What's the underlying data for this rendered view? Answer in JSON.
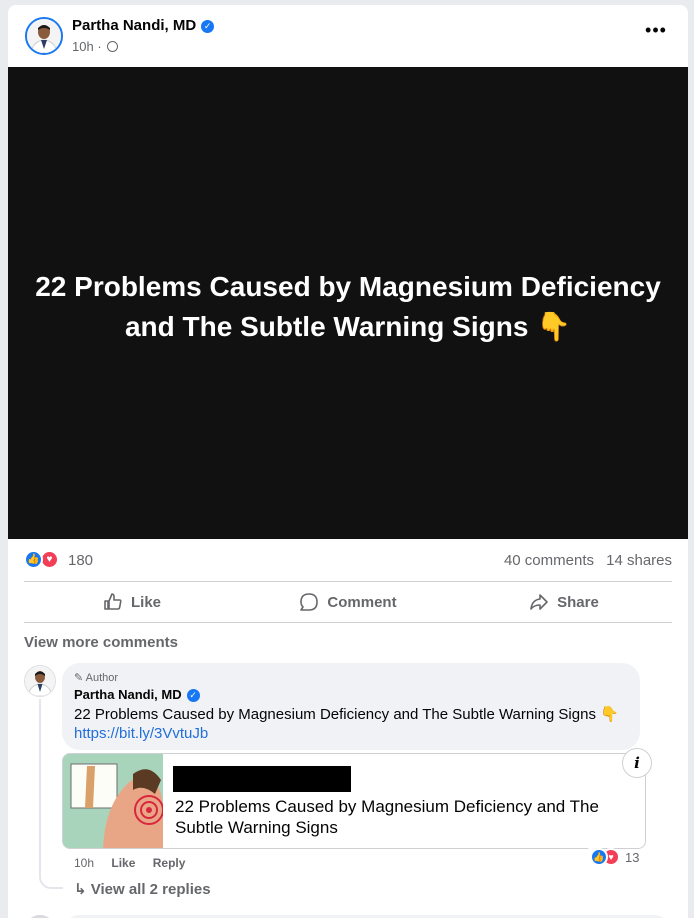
{
  "post": {
    "author": "Partha Nandi, MD",
    "verified_mark": "✓",
    "time": "10h",
    "separator": "·",
    "more_label": "•••",
    "media_text": "22 Problems Caused by Magnesium Deficiency and The Subtle Warning Signs 👇"
  },
  "stats": {
    "reaction_count": "180",
    "comments": "40 comments",
    "shares": "14 shares"
  },
  "actions": {
    "like": "Like",
    "comment": "Comment",
    "share": "Share"
  },
  "comments_section": {
    "view_more": "View more comments",
    "comment": {
      "badge": "Author",
      "author": "Partha Nandi, MD",
      "text": "22 Problems Caused by Magnesium Deficiency and The Subtle Warning Signs 👇",
      "link": "https://bit.ly/3VvtuJb",
      "preview_title": "22 Problems Caused by Magnesium Deficiency and The Subtle Warning Signs",
      "info_label": "i",
      "time": "10h",
      "like": "Like",
      "reply": "Reply",
      "reaction_count": "13",
      "view_replies": "View all 2 replies"
    }
  },
  "icons": {
    "like_reaction": "like-reaction-icon",
    "love_reaction": "love-reaction-icon",
    "globe": "globe-icon",
    "reply_arrow": "reply-arrow-icon"
  },
  "colors": {
    "accent": "#1877f2",
    "love": "#f33e58",
    "link": "#216fdb",
    "media_bg": "#111112"
  }
}
